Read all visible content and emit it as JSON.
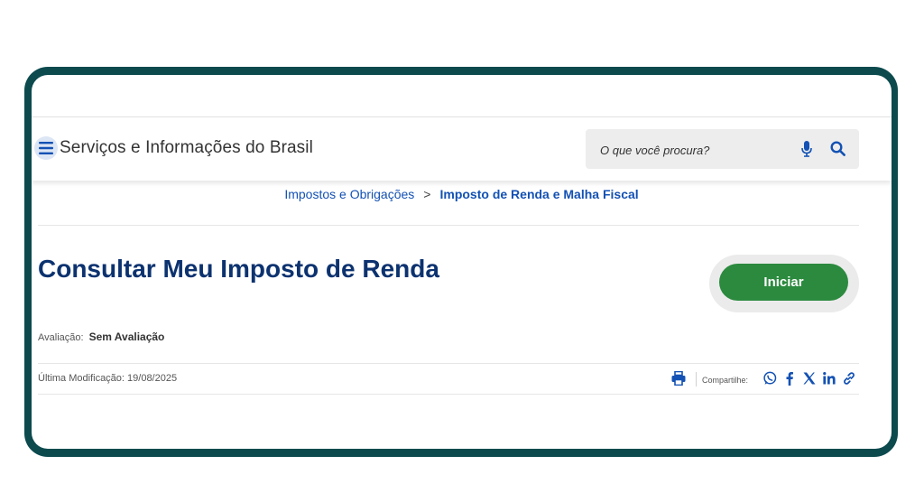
{
  "header": {
    "site_title": "Serviços e Informações do Brasil",
    "search_placeholder": "O que você procura?"
  },
  "breadcrumb": {
    "items": [
      "Impostos e Obrigações",
      "Imposto de Renda e Malha Fiscal"
    ],
    "separator": ">"
  },
  "service": {
    "title": "Consultar Meu Imposto de Renda",
    "start_label": "Iniciar",
    "rating_label": "Avaliação:",
    "rating_value": "Sem Avaliação",
    "modified_text": "Última Modificação: 19/08/2025"
  },
  "share": {
    "label": "Compartilhe:",
    "icons": [
      "print-icon",
      "whatsapp-icon",
      "facebook-icon",
      "x-icon",
      "linkedin-icon",
      "link-icon"
    ]
  },
  "colors": {
    "frame": "#0c4a4e",
    "primary_blue": "#1351b4",
    "title_blue": "#0c326f",
    "cta_green": "#2b8a3e"
  }
}
